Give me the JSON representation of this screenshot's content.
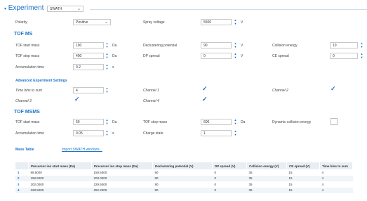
{
  "header": {
    "title": "Experiment",
    "mode": "SWATH"
  },
  "polarity": {
    "label": "Polarity",
    "value": "Positive"
  },
  "spray_voltage": {
    "label": "Spray voltage",
    "value": "5500",
    "unit": "V"
  },
  "tof_ms": {
    "title": "TOF MS",
    "start_mass": {
      "label": "TOF start mass",
      "value": "100",
      "unit": "Da"
    },
    "stop_mass": {
      "label": "TOF stop mass",
      "value": "400",
      "unit": "Da"
    },
    "accum_time": {
      "label": "Accumulation time",
      "value": "0.2",
      "unit": "s"
    },
    "declustering": {
      "label": "Declustering potential",
      "value": "90",
      "unit": "V"
    },
    "dp_spread": {
      "label": "DP spread",
      "value": "0",
      "unit": "V"
    },
    "collision_energy": {
      "label": "Collision energy",
      "value": "10",
      "unit": "V"
    },
    "ce_spread": {
      "label": "CE spread",
      "value": "0",
      "unit": "V"
    }
  },
  "advanced": {
    "title": "Advanced Experiment Settings",
    "time_bins": {
      "label": "Time bins to sum",
      "value": "4"
    },
    "channel1": {
      "label": "Channel 1",
      "checked": true
    },
    "channel2": {
      "label": "Channel 2",
      "checked": true
    },
    "channel3": {
      "label": "Channel 3",
      "checked": true
    },
    "channel4": {
      "label": "Channel 4",
      "checked": true
    }
  },
  "tof_msms": {
    "title": "TOF MSMS",
    "start_mass": {
      "label": "TOF start mass",
      "value": "50",
      "unit": "Da"
    },
    "stop_mass": {
      "label": "TOF stop mass",
      "value": "600",
      "unit": "Da"
    },
    "accum_time": {
      "label": "Accumulation time",
      "value": "0.05",
      "unit": "s"
    },
    "charge_state": {
      "label": "Charge state",
      "value": "1"
    },
    "dynamic_ce": {
      "label": "Dynamic collision energy",
      "checked": false
    }
  },
  "mass_table": {
    "title": "Mass Table",
    "link": "Import SWATH windows...",
    "columns": [
      "",
      "Precursor ion start mass (Da)",
      "Precursor ion stop mass (Da)",
      "Declustering potential (V)",
      "DP spread (V)",
      "Collision energy (V)",
      "CE spread (V)",
      "Time bins to sum"
    ],
    "rows": [
      [
        "1",
        "99.5000",
        "159.5000",
        "80",
        "0",
        "35",
        "15",
        "4"
      ],
      [
        "2",
        "158.5000",
        "203.0000",
        "80",
        "0",
        "35",
        "15",
        "4"
      ],
      [
        "3",
        "202.0000",
        "229.5000",
        "80",
        "0",
        "35",
        "15",
        "4"
      ],
      [
        "4",
        "228.5000",
        "252.2000",
        "80",
        "0",
        "35",
        "15",
        "4"
      ]
    ]
  },
  "icons": {
    "spin": "spin-arrows-icon",
    "caret": "chevron-down-icon",
    "check": "checkmark-icon"
  },
  "colors": {
    "accent": "#1a73c8"
  }
}
